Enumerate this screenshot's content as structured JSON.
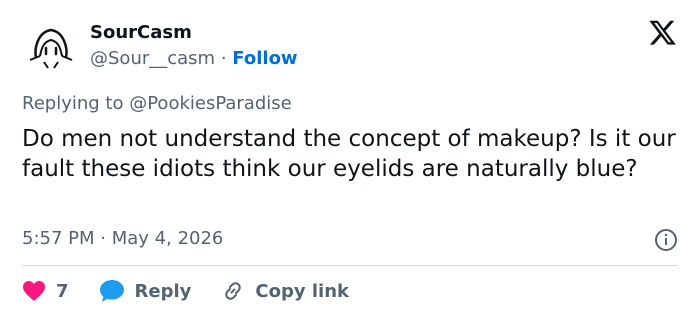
{
  "author": {
    "name": "SourCasm",
    "handle": "@Sour__casm",
    "separator": "·",
    "follow_label": "Follow"
  },
  "reply_to": {
    "prefix": "Replying to",
    "mention": "@PookiesParadise"
  },
  "body": "Do men not understand the concept of makeup? Is it our fault these idiots think our eyelids are naturally blue?",
  "timestamp": {
    "time": "5:57 PM",
    "separator": "·",
    "date": "May 4, 2026"
  },
  "actions": {
    "like_count": "7",
    "reply_label": "Reply",
    "copy_label": "Copy link"
  },
  "colors": {
    "like": "#f91880",
    "reply": "#1d9bf0",
    "follow": "#006fd6",
    "muted": "#536471"
  },
  "icons": {
    "logo": "x-logo-icon",
    "info": "info-icon",
    "like": "heart-icon",
    "reply": "speech-bubble-icon",
    "copy": "link-icon"
  }
}
